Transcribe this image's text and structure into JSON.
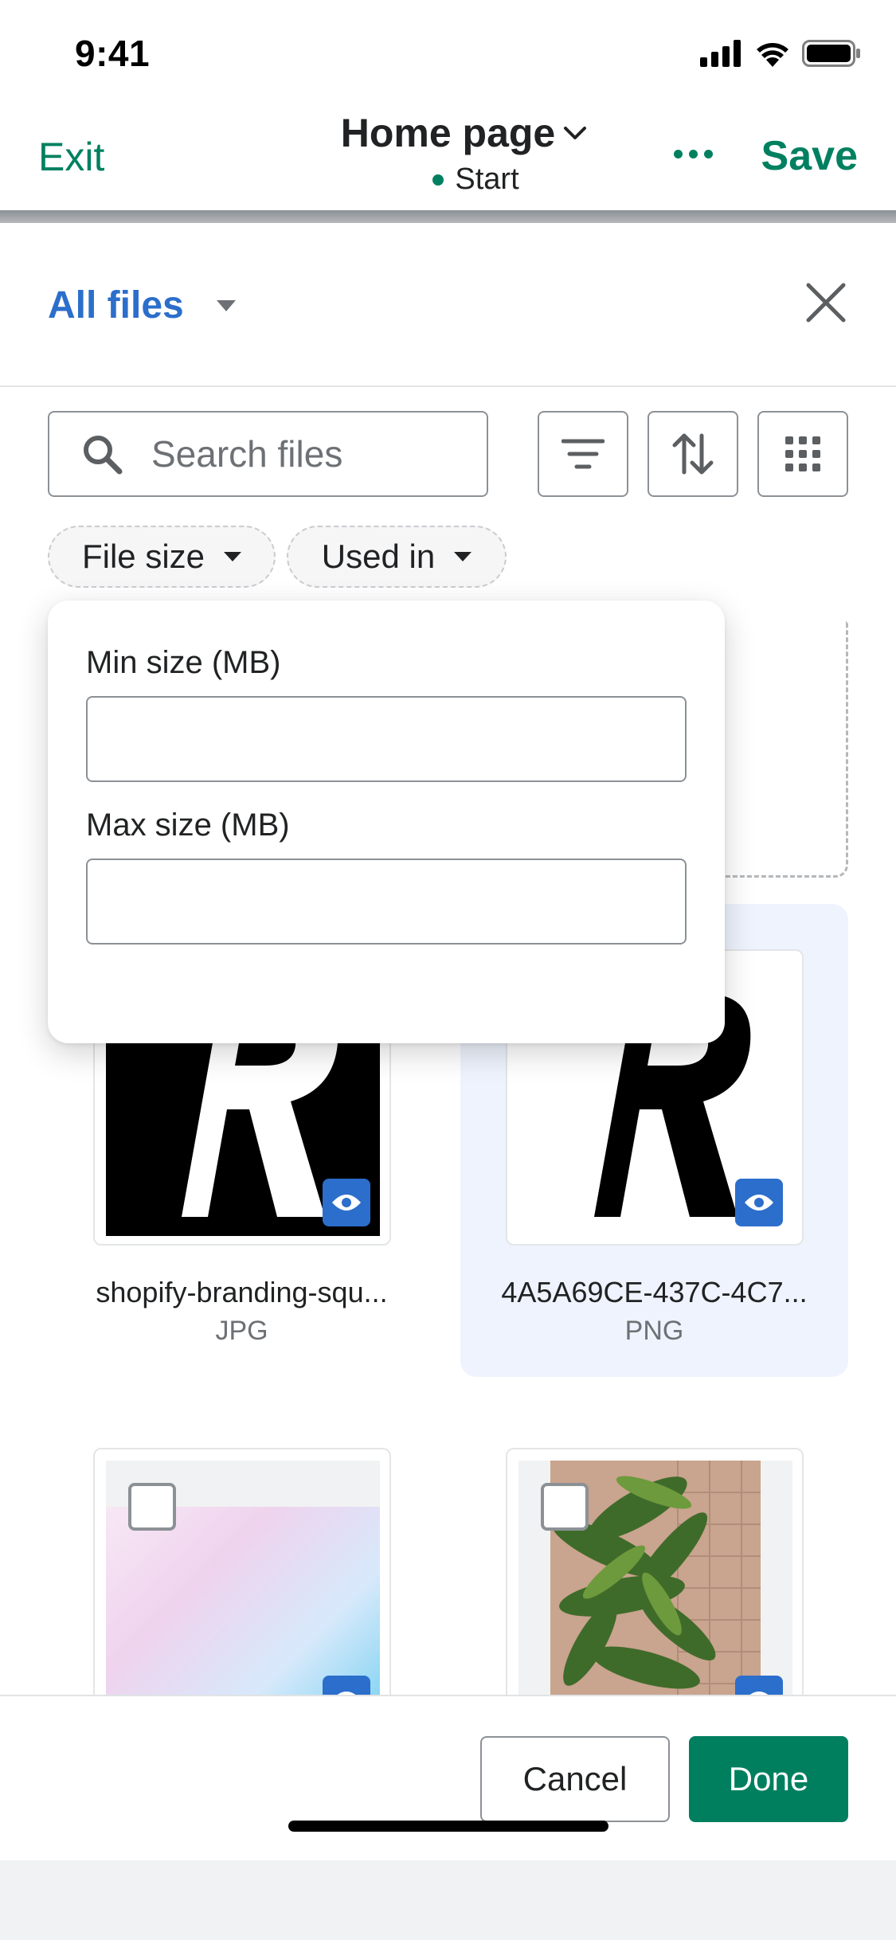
{
  "status_bar": {
    "time": "9:41"
  },
  "header": {
    "exit_label": "Exit",
    "title": "Home page",
    "subtitle": "Start",
    "save_label": "Save",
    "accent_color": "#008060"
  },
  "sheet": {
    "scope_label": "All files"
  },
  "search": {
    "placeholder": "Search files"
  },
  "filters": [
    {
      "label": "File size"
    },
    {
      "label": "Used in"
    }
  ],
  "popover": {
    "min_label": "Min size (MB)",
    "min_value": "",
    "max_label": "Max size (MB)",
    "max_value": ""
  },
  "files": [
    {
      "name": "shopify-branding-squ...",
      "type": "JPG",
      "selected": false
    },
    {
      "name": "4A5A69CE-437C-4C7...",
      "type": "PNG",
      "selected": true
    },
    {
      "name": "",
      "type": "",
      "selected": false
    },
    {
      "name": "",
      "type": "",
      "selected": false
    }
  ],
  "footer": {
    "cancel_label": "Cancel",
    "done_label": "Done",
    "primary_color": "#007f5f"
  },
  "icons": [
    "signal-icon",
    "wifi-icon",
    "battery-icon",
    "chevron-down-icon",
    "more-icon",
    "close-icon",
    "search-icon",
    "filter-icon",
    "sort-icon",
    "grid-view-icon",
    "caret-down-icon",
    "eye-icon"
  ]
}
